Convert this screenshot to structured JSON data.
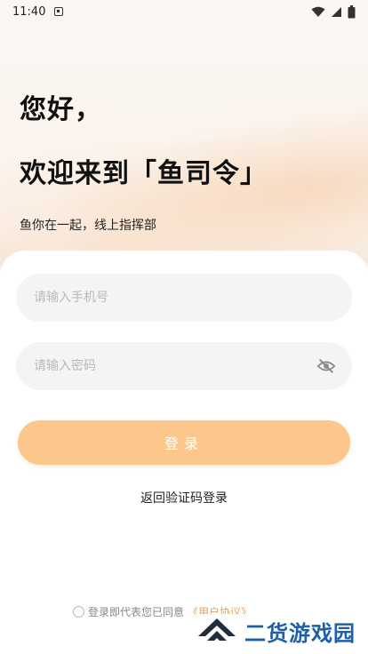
{
  "status_bar": {
    "time": "11:40",
    "icons": [
      "app-notification-icon",
      "wifi-icon",
      "signal-icon",
      "battery-icon"
    ]
  },
  "header": {
    "greeting": "您好，",
    "welcome": "欢迎来到「鱼司令」",
    "tagline": "鱼你在一起，线上指挥部"
  },
  "form": {
    "phone_placeholder": "请输入手机号",
    "password_placeholder": "请输入密码",
    "password_toggle_icon": "eye-off-icon",
    "login_label": "登录",
    "back_link": "返回验证码登录"
  },
  "agreement": {
    "text": "登录即代表您已同意",
    "link": "《用户协议》",
    "checked": false
  },
  "watermark": {
    "text": "二货游戏园"
  },
  "colors": {
    "accent": "#fbc78a",
    "background_warm": "#fbf2ea",
    "input_bg": "#f4f4f4",
    "placeholder": "#b9b9b9",
    "watermark_blue": "#1e5fa8"
  }
}
